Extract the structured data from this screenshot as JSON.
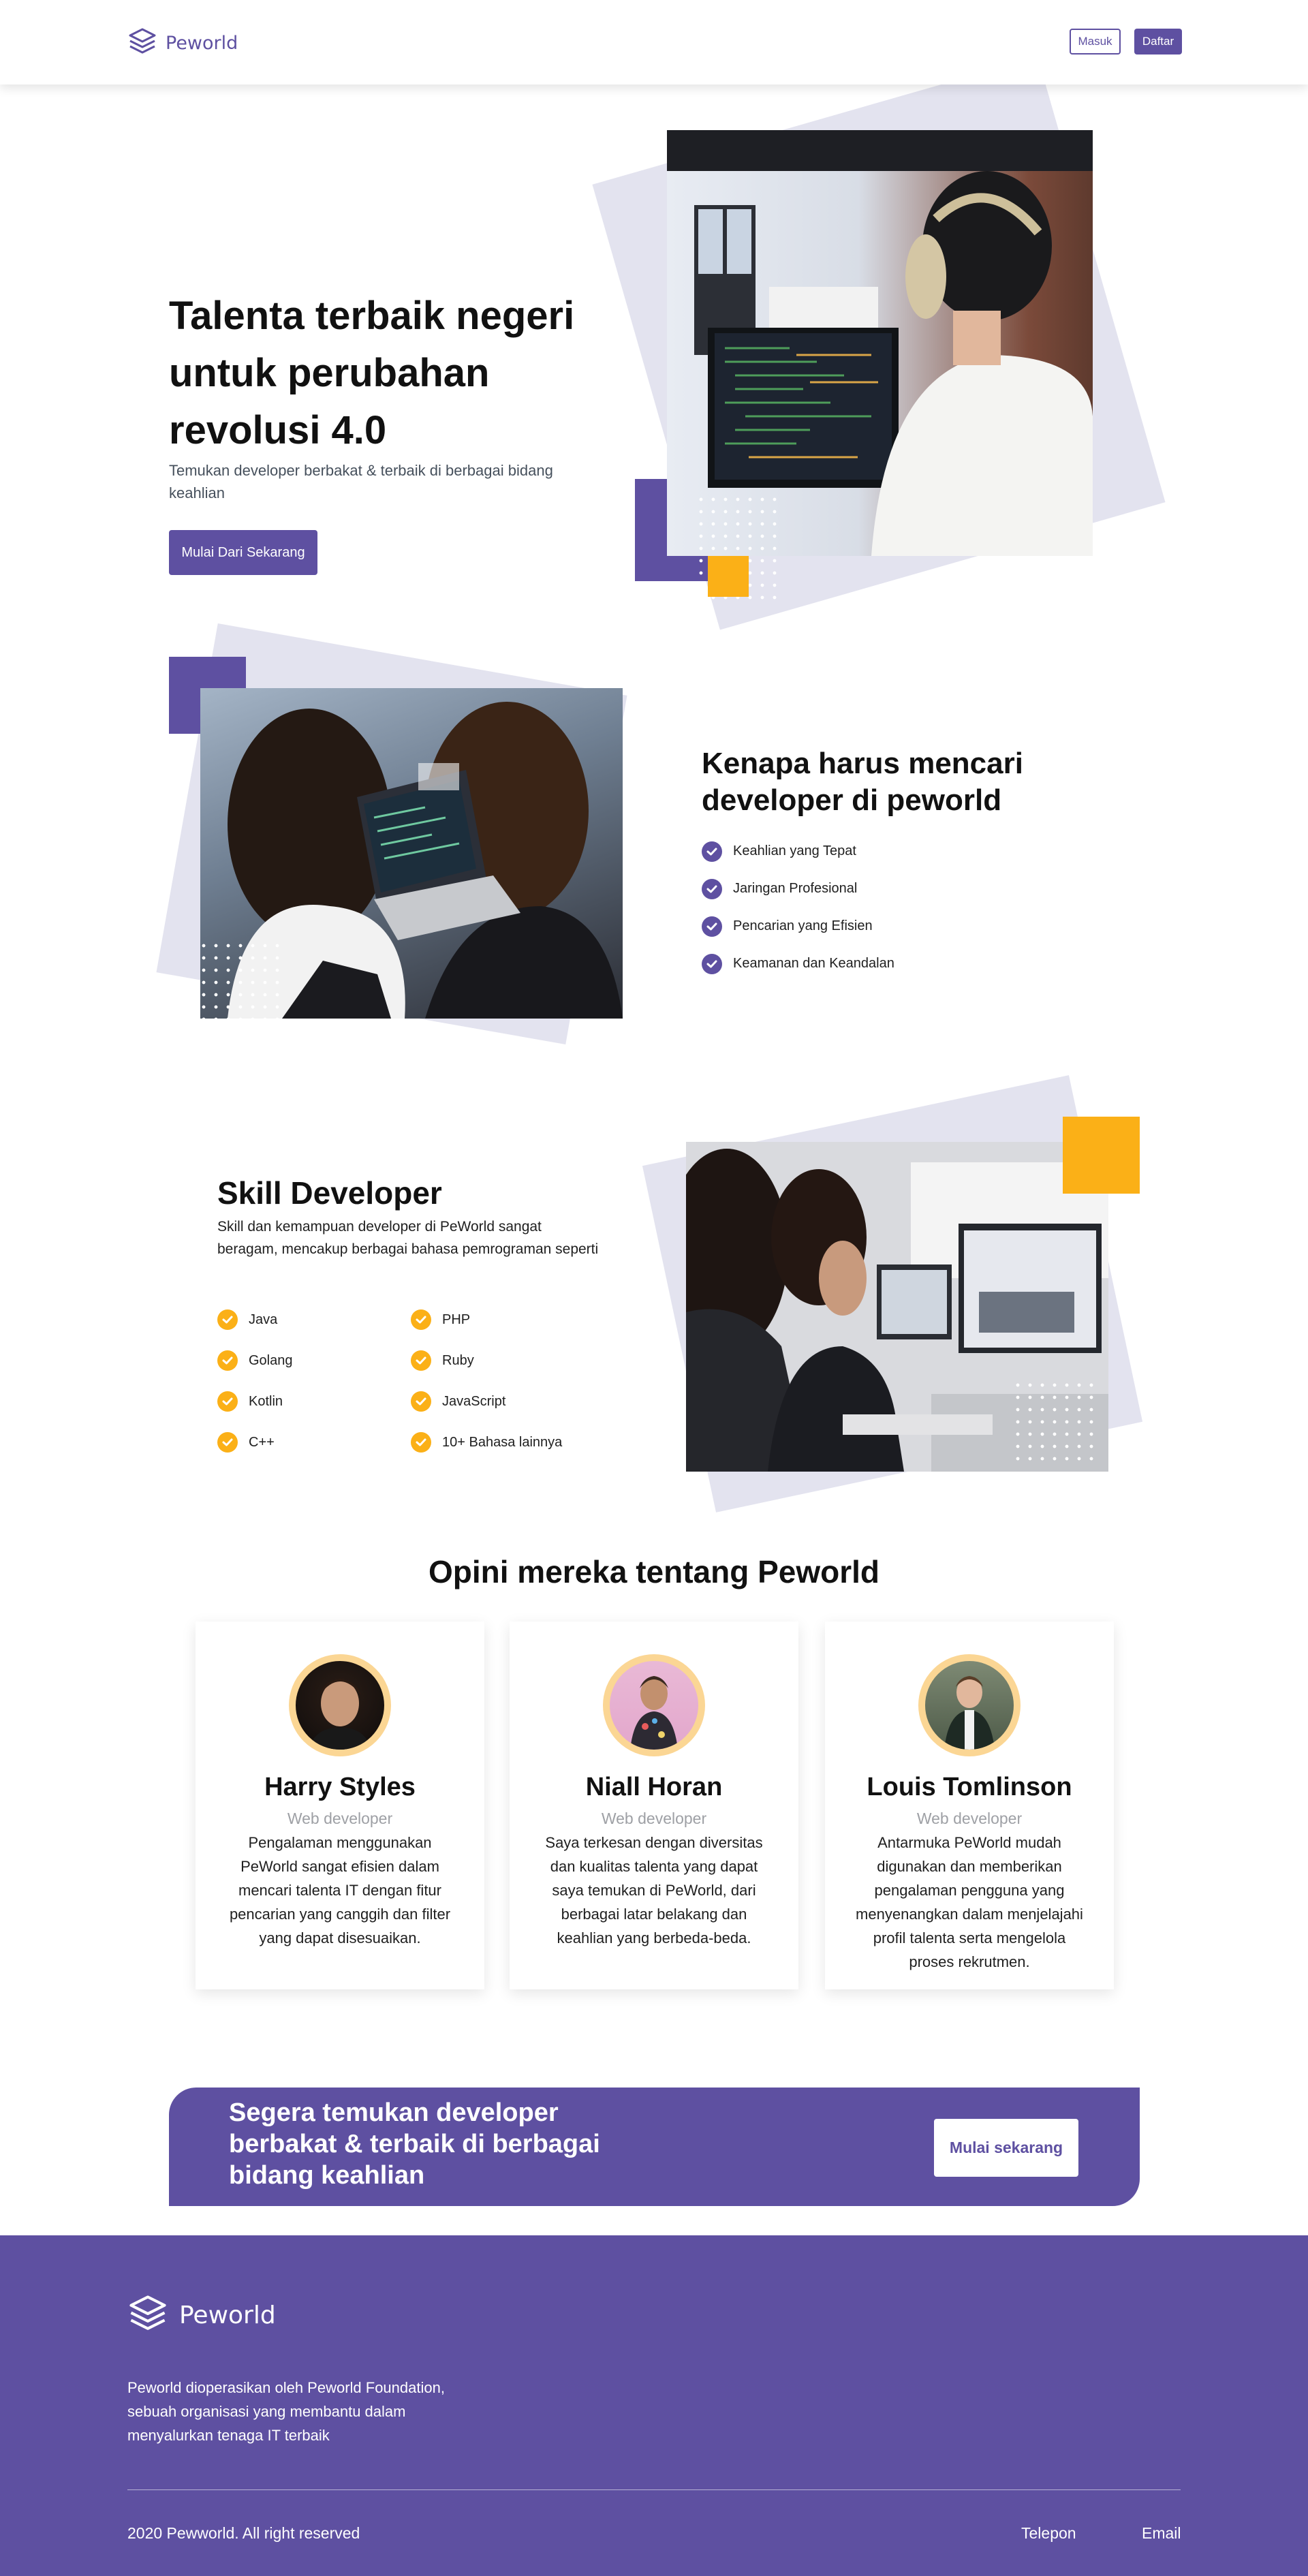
{
  "brand": {
    "name": "Peworld",
    "primary": "#5e50a1",
    "accent": "#fbb017",
    "logo_icon": "layers-icon"
  },
  "nav": {
    "login_label": "Masuk",
    "register_label": "Daftar"
  },
  "hero": {
    "title": "Talenta terbaik negeri untuk perubahan revolusi 4.0",
    "subtitle": "Temukan developer berbakat & terbaik di berbagai bidang keahlian",
    "cta_label": "Mulai Dari Sekarang"
  },
  "why": {
    "title": "Kenapa harus mencari developer di peworld",
    "items": [
      {
        "label": "Keahlian yang Tepat"
      },
      {
        "label": "Jaringan Profesional"
      },
      {
        "label": "Pencarian yang Efisien"
      },
      {
        "label": "Keamanan dan Keandalan"
      }
    ]
  },
  "skill": {
    "title": "Skill Developer",
    "description": "Skill dan kemampuan developer di PeWorld sangat beragam, mencakup berbagai bahasa pemrograman seperti",
    "items": [
      "Java",
      "PHP",
      "Golang",
      "Ruby",
      "Kotlin",
      "JavaScript",
      "C++",
      "10+ Bahasa lainnya"
    ]
  },
  "testimonials": {
    "title": "Opini mereka tentang Peworld",
    "cards": [
      {
        "name": "Harry Styles",
        "role": "Web developer",
        "quote": "Pengalaman menggunakan PeWorld sangat efisien dalam mencari talenta IT dengan fitur pencarian yang canggih dan filter yang dapat disesuaikan."
      },
      {
        "name": "Niall Horan",
        "role": "Web developer",
        "quote": "Saya terkesan dengan diversitas dan kualitas talenta yang dapat saya temukan di PeWorld, dari berbagai latar belakang dan keahlian yang berbeda-beda."
      },
      {
        "name": "Louis Tomlinson",
        "role": "Web developer",
        "quote": "Antarmuka PeWorld mudah digunakan dan memberikan pengalaman pengguna yang menyenangkan dalam menjelajahi profil talenta serta mengelola proses rekrutmen."
      }
    ]
  },
  "banner": {
    "text": "Segera temukan developer berbakat & terbaik di berbagai bidang keahlian",
    "button_label": "Mulai sekarang"
  },
  "footer": {
    "about": "Peworld dioperasikan oleh Peworld Foundation, sebuah organisasi yang membantu dalam menyalurkan tenaga IT terbaik",
    "copyright": "2020 Pewworld. All right reserved",
    "links": [
      "Telepon",
      "Email"
    ]
  }
}
